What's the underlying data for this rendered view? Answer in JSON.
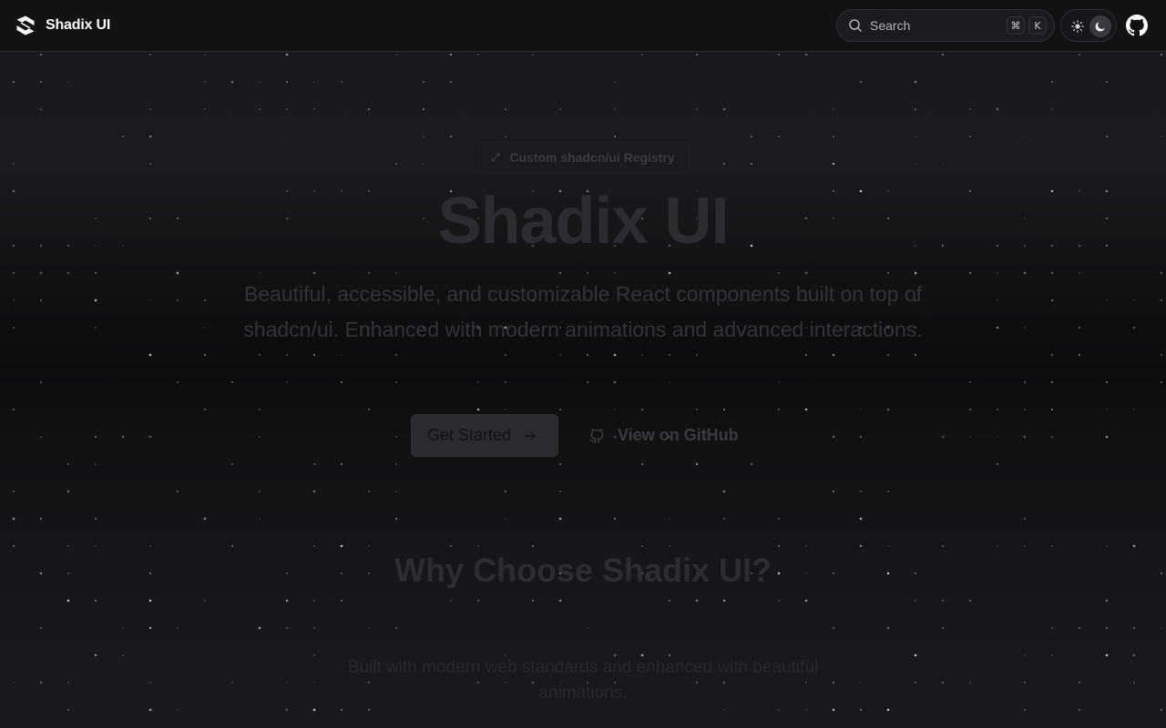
{
  "brand": {
    "name": "Shadix UI"
  },
  "header": {
    "search_label": "Search",
    "search_shortcut": [
      "⌘",
      "K"
    ]
  },
  "hero": {
    "badge": "Custom shadcn/ui Registry",
    "title": "Shadix UI",
    "description": "Beautiful, accessible, and customizable React components built on top of shadcn/ui. Enhanced with modern animations and advanced interactions.",
    "primary_cta": "Get Started",
    "secondary_cta": "View on GitHub"
  },
  "features": {
    "title": "Why Choose Shadix UI?",
    "subtitle": "Built with modern web standards and enhanced with beautiful animations."
  },
  "icons": {
    "logo": "shadix-logo-icon",
    "search": "search-icon",
    "sun": "sun-icon",
    "moon": "moon-icon",
    "github": "github-icon",
    "arrow": "arrow-right-icon",
    "sparkle": "sparkle-icon"
  },
  "colors": {
    "background": "#161618",
    "header": "#121213",
    "text": "#fafafa"
  }
}
